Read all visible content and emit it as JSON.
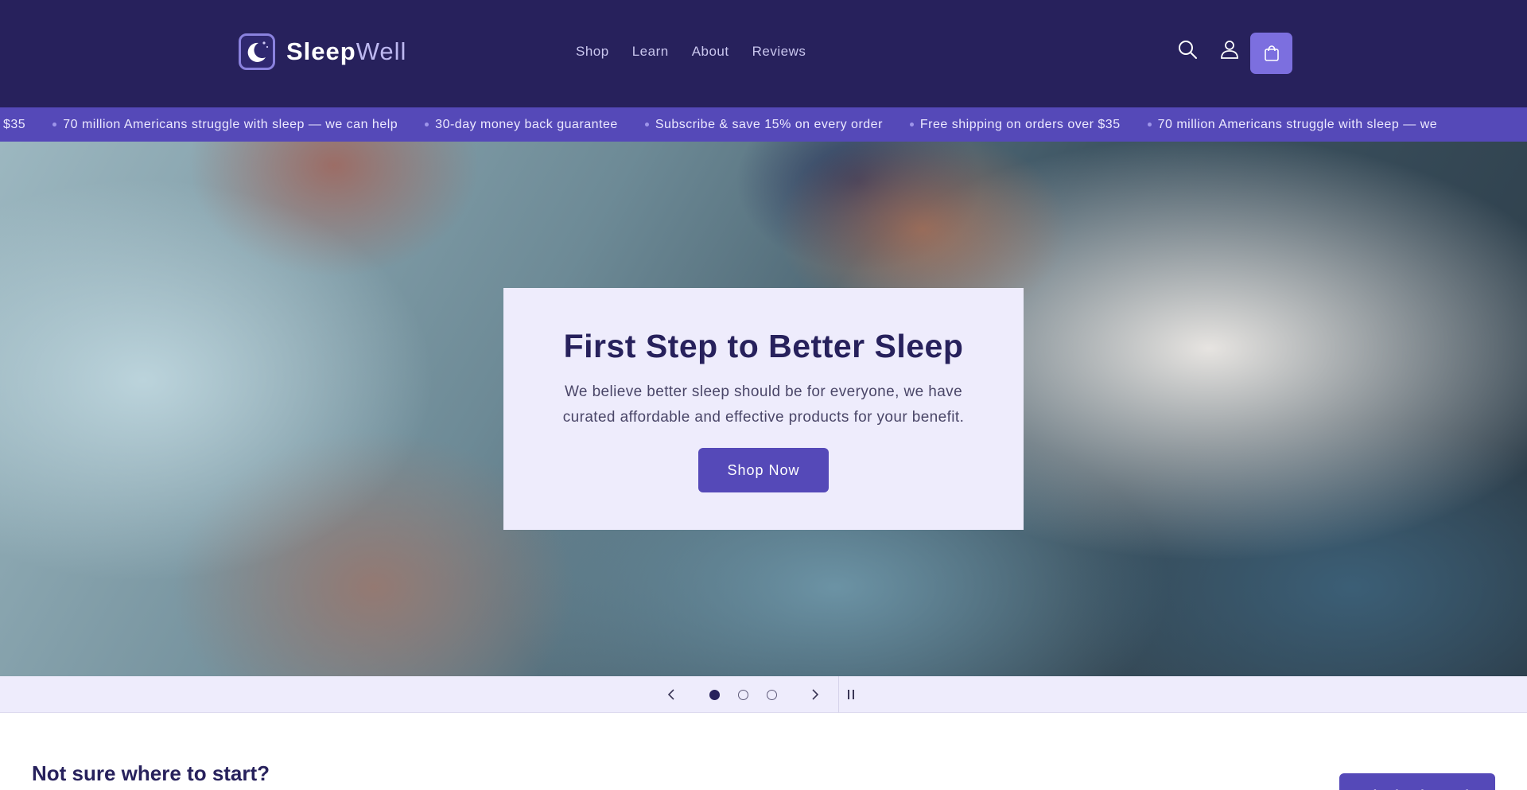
{
  "brand": {
    "name_bold": "Sleep",
    "name_light": "Well",
    "logo_icon": "crescent-moon-icon"
  },
  "nav": {
    "items": [
      {
        "label": "Shop"
      },
      {
        "label": "Learn"
      },
      {
        "label": "About"
      },
      {
        "label": "Reviews"
      }
    ]
  },
  "header_icons": {
    "search": "search-icon",
    "account": "account-icon",
    "cart": "cart-icon"
  },
  "announcement": {
    "items": [
      "$35",
      "70 million Americans struggle with sleep — we can help",
      "30-day money back guarantee",
      "Subscribe & save 15% on every order",
      "Free shipping on orders over $35",
      "70 million Americans struggle with sleep — we"
    ]
  },
  "hero": {
    "title": "First Step to Better Sleep",
    "subtitle": "We believe better sleep should be for everyone, we have curated affordable and effective products for your benefit.",
    "cta": "Shop Now"
  },
  "slider": {
    "slide_count": 3,
    "active_index": 1,
    "prev_icon": "chevron-left-icon",
    "next_icon": "chevron-right-icon",
    "pause_icon": "pause-icon"
  },
  "section": {
    "title": "Not sure where to start?",
    "cta": "Take the sleep quiz"
  },
  "colors": {
    "header_bg": "#27215c",
    "accent": "#5549b8",
    "cart_bg": "#7c6fdf",
    "card_bg": "#eeecfc"
  }
}
